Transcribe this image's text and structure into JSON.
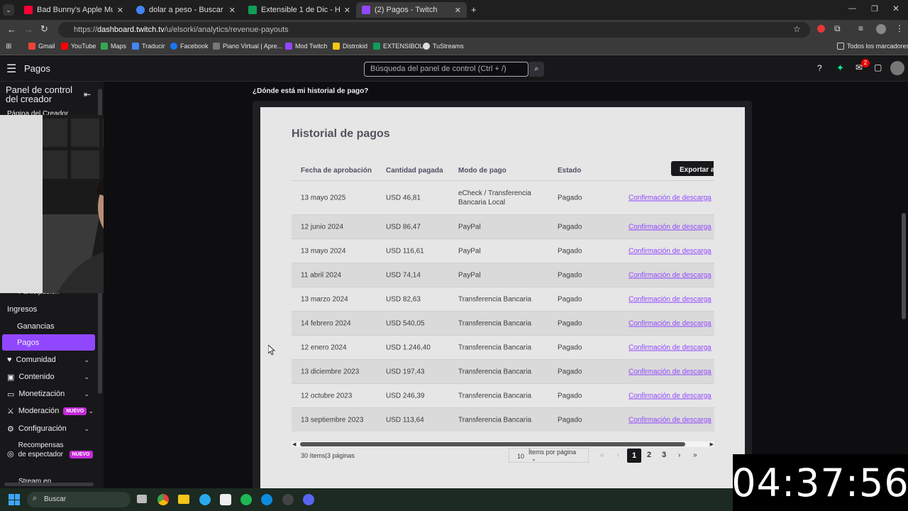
{
  "browser": {
    "tabs": [
      {
        "label": "Bad Bunny's Apple Music Super",
        "color": "#ff0033"
      },
      {
        "label": "dolar a peso - Buscar con Goog",
        "color": "#4285f4"
      },
      {
        "label": "Extensible 1 de Dic - Hojas de",
        "color": "#0f9d58"
      },
      {
        "label": "(2) Pagos - Twitch",
        "color": "#9147ff"
      }
    ],
    "url_prefix": "https://",
    "url_domain": "dashboard.twitch.tv",
    "url_path": "/u/elsorki/analytics/revenue-payouts",
    "bookmarks": [
      "Gmail",
      "YouTube",
      "Maps",
      "Traducir",
      "Facebook",
      "Piano Virtual | Apre...",
      "Mod Twitch",
      "Distrokid",
      "EXTENSIBOL",
      "TuStreams"
    ],
    "bookmarks_all": "Todos los marcadores"
  },
  "header": {
    "title": "Pagos",
    "search_placeholder": "Búsqueda del panel de control (Ctrl + /)",
    "notif_count": "2"
  },
  "sidebar": {
    "title": "Panel de control del creador",
    "creator_page": "Página del Creador",
    "participation": "Participación",
    "income": "Ingresos",
    "earnings": "Ganancias",
    "payouts": "Pagos",
    "community": "Comunidad",
    "content": "Contenido",
    "monetization": "Monetización",
    "moderation": "Moderación",
    "new_badge": "NUEVO",
    "settings": "Configuración",
    "rewards": "Recompensas de espectador",
    "stream": "Stream en"
  },
  "main": {
    "history_question": "¿Dónde está mi historial de pago?",
    "card_title": "Historial de pagos",
    "export_label": "Exportar a",
    "columns": [
      "Fecha de aprobación",
      "Cantidad pagada",
      "Modo de pago",
      "Estado"
    ],
    "rows": [
      {
        "date": "13 mayo 2025",
        "amount": "USD 46,81",
        "method": "eCheck / Transferencia Bancaria Local",
        "status": "Pagado",
        "link": "Confirmación de descarga"
      },
      {
        "date": "12 junio 2024",
        "amount": "USD 86,47",
        "method": "PayPal",
        "status": "Pagado",
        "link": "Confirmación de descarga"
      },
      {
        "date": "13 mayo 2024",
        "amount": "USD 116,61",
        "method": "PayPal",
        "status": "Pagado",
        "link": "Confirmación de descarga"
      },
      {
        "date": "11 abril 2024",
        "amount": "USD 74,14",
        "method": "PayPal",
        "status": "Pagado",
        "link": "Confirmación de descarga"
      },
      {
        "date": "13 marzo 2024",
        "amount": "USD 82,63",
        "method": "Transferencia Bancaria",
        "status": "Pagado",
        "link": "Confirmación de descarga"
      },
      {
        "date": "14 febrero 2024",
        "amount": "USD 540,05",
        "method": "Transferencia Bancaria",
        "status": "Pagado",
        "link": "Confirmación de descarga"
      },
      {
        "date": "12 enero 2024",
        "amount": "USD 1.246,40",
        "method": "Transferencia Bancaria",
        "status": "Pagado",
        "link": "Confirmación de descarga"
      },
      {
        "date": "13 diciembre 2023",
        "amount": "USD 197,43",
        "method": "Transferencia Bancaria",
        "status": "Pagado",
        "link": "Confirmación de descarga"
      },
      {
        "date": "12 octubre 2023",
        "amount": "USD 246,39",
        "method": "Transferencia Bancaria",
        "status": "Pagado",
        "link": "Confirmación de descarga"
      },
      {
        "date": "13 septiembre 2023",
        "amount": "USD 113,64",
        "method": "Transferencia Bancaria",
        "status": "Pagado",
        "link": "Confirmación de descarga"
      }
    ],
    "items_summary": "30 ítems|3 páginas",
    "per_page_value": "10",
    "per_page_label": "Ítems por página",
    "pages": [
      "1",
      "2",
      "3"
    ],
    "current_page": "1"
  },
  "taskbar": {
    "search": "Buscar"
  },
  "overlay_clock": "04:37:56"
}
